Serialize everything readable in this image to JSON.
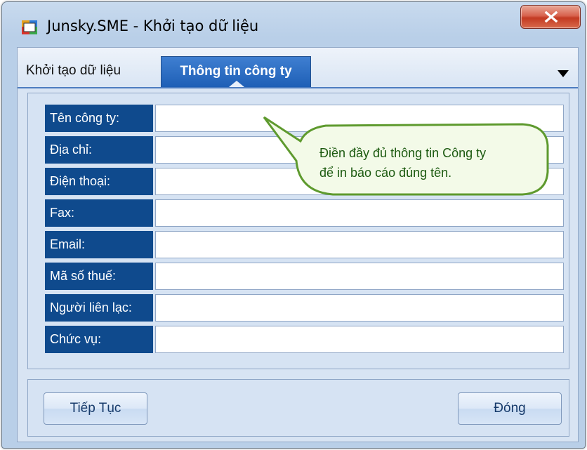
{
  "window": {
    "title": "Junsky.SME - Khởi tạo dữ liệu"
  },
  "tabs": [
    {
      "label": "Khởi tạo dữ liệu",
      "active": false
    },
    {
      "label": "Thông tin công ty",
      "active": true
    }
  ],
  "form": {
    "fields": [
      {
        "label": "Tên công ty:",
        "value": ""
      },
      {
        "label": "Địa chỉ:",
        "value": ""
      },
      {
        "label": "Điện thoại:",
        "value": ""
      },
      {
        "label": "Fax:",
        "value": ""
      },
      {
        "label": "Email:",
        "value": ""
      },
      {
        "label": "Mã số thuế:",
        "value": ""
      },
      {
        "label": "Người liên lạc:",
        "value": ""
      },
      {
        "label": "Chức vụ:",
        "value": ""
      }
    ]
  },
  "callout": {
    "line1": "Điền đầy đủ thông tin Công ty",
    "line2": "để in báo cáo đúng tên."
  },
  "buttons": {
    "next": "Tiếp Tục",
    "close": "Đóng"
  },
  "colors": {
    "label_bg": "#0f4a8d",
    "active_tab": "#2a68bd",
    "callout_border": "#5e9a2e"
  },
  "icons": {
    "app": "app-window-icon",
    "close": "close-icon",
    "dropdown": "dropdown-arrow-icon"
  }
}
